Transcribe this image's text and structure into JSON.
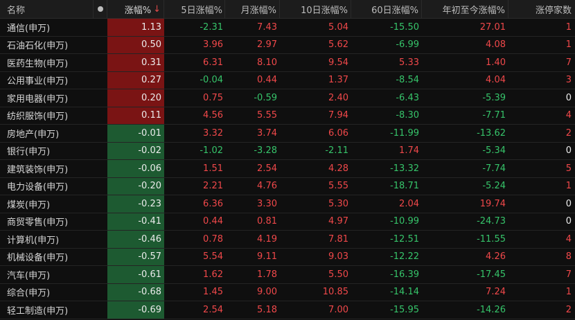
{
  "header": {
    "name": "名称",
    "change": "涨幅%",
    "sort_arrow": "↓",
    "chg5d": "5日涨幅%",
    "chg_month": "月涨幅%",
    "chg10d": "10日涨幅%",
    "chg60d": "60日涨幅%",
    "chg_ytd": "年初至今涨幅%",
    "limit_up": "涨停家数"
  },
  "colors": {
    "up": "#f0484a",
    "down": "#36c46a",
    "up_bg": "#7a1414",
    "down_bg": "#1d5a31"
  },
  "rows": [
    {
      "name": "通信(申万)",
      "chg": "1.13",
      "d5": "-2.31",
      "m": "7.43",
      "d10": "5.04",
      "d60": "-15.50",
      "ytd": "27.01",
      "lim": "1"
    },
    {
      "name": "石油石化(申万)",
      "chg": "0.50",
      "d5": "3.96",
      "m": "2.97",
      "d10": "5.62",
      "d60": "-6.99",
      "ytd": "4.08",
      "lim": "1"
    },
    {
      "name": "医药生物(申万)",
      "chg": "0.31",
      "d5": "6.31",
      "m": "8.10",
      "d10": "9.54",
      "d60": "5.33",
      "ytd": "1.40",
      "lim": "7"
    },
    {
      "name": "公用事业(申万)",
      "chg": "0.27",
      "d5": "-0.04",
      "m": "0.44",
      "d10": "1.37",
      "d60": "-8.54",
      "ytd": "4.04",
      "lim": "3"
    },
    {
      "name": "家用电器(申万)",
      "chg": "0.20",
      "d5": "0.75",
      "m": "-0.59",
      "d10": "2.40",
      "d60": "-6.43",
      "ytd": "-5.39",
      "lim": "0"
    },
    {
      "name": "纺织服饰(申万)",
      "chg": "0.11",
      "d5": "4.56",
      "m": "5.55",
      "d10": "7.94",
      "d60": "-8.30",
      "ytd": "-7.71",
      "lim": "4"
    },
    {
      "name": "房地产(申万)",
      "chg": "-0.01",
      "d5": "3.32",
      "m": "3.74",
      "d10": "6.06",
      "d60": "-11.99",
      "ytd": "-13.62",
      "lim": "2"
    },
    {
      "name": "银行(申万)",
      "chg": "-0.02",
      "d5": "-1.02",
      "m": "-3.28",
      "d10": "-2.11",
      "d60": "1.74",
      "ytd": "-5.34",
      "lim": "0"
    },
    {
      "name": "建筑装饰(申万)",
      "chg": "-0.06",
      "d5": "1.51",
      "m": "2.54",
      "d10": "4.28",
      "d60": "-13.32",
      "ytd": "-7.74",
      "lim": "5"
    },
    {
      "name": "电力设备(申万)",
      "chg": "-0.20",
      "d5": "2.21",
      "m": "4.76",
      "d10": "5.55",
      "d60": "-18.71",
      "ytd": "-5.24",
      "lim": "1"
    },
    {
      "name": "煤炭(申万)",
      "chg": "-0.23",
      "d5": "6.36",
      "m": "3.30",
      "d10": "5.30",
      "d60": "2.04",
      "ytd": "19.74",
      "lim": "0"
    },
    {
      "name": "商贸零售(申万)",
      "chg": "-0.41",
      "d5": "0.44",
      "m": "0.81",
      "d10": "4.97",
      "d60": "-10.99",
      "ytd": "-24.73",
      "lim": "0"
    },
    {
      "name": "计算机(申万)",
      "chg": "-0.46",
      "d5": "0.78",
      "m": "4.19",
      "d10": "7.81",
      "d60": "-12.51",
      "ytd": "-11.55",
      "lim": "4"
    },
    {
      "name": "机械设备(申万)",
      "chg": "-0.57",
      "d5": "5.54",
      "m": "9.11",
      "d10": "9.03",
      "d60": "-12.22",
      "ytd": "4.26",
      "lim": "8"
    },
    {
      "name": "汽车(申万)",
      "chg": "-0.61",
      "d5": "1.62",
      "m": "1.78",
      "d10": "5.50",
      "d60": "-16.39",
      "ytd": "-17.45",
      "lim": "7"
    },
    {
      "name": "综合(申万)",
      "chg": "-0.68",
      "d5": "1.45",
      "m": "9.00",
      "d10": "10.85",
      "d60": "-14.14",
      "ytd": "7.24",
      "lim": "1"
    },
    {
      "name": "轻工制造(申万)",
      "chg": "-0.69",
      "d5": "2.54",
      "m": "5.18",
      "d10": "7.00",
      "d60": "-15.95",
      "ytd": "-14.26",
      "lim": "2"
    }
  ]
}
